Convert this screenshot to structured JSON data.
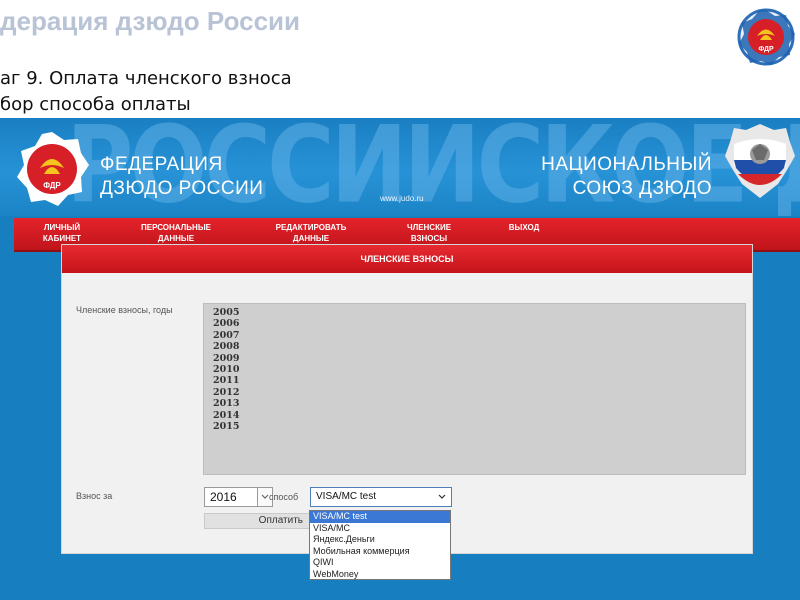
{
  "slide": {
    "title": "дерация дзюдо России",
    "step_line1": "аг 9. Оплата членского взноса",
    "step_line2": "бор способа оплаты",
    "logo_text": "ФДР"
  },
  "screenshot": {
    "banner": {
      "watermark": "РОССИЙСКОЕ ДЗЮДО",
      "emblem_text": "ФДР",
      "federation_line1": "ФЕДЕРАЦИЯ",
      "federation_line2": "ДЗЮДО РОССИИ",
      "site_url": "www.judo.ru",
      "national_line1": "НАЦИОНАЛЬНЫЙ",
      "national_line2": "СОЮЗ ДЗЮДО"
    },
    "nav": {
      "items": [
        {
          "line1": "ЛИЧНЫЙ",
          "line2": "КАБИНЕТ"
        },
        {
          "line1": "ПЕРСОНАЛЬНЫЕ",
          "line2": "ДАННЫЕ"
        },
        {
          "line1": "РЕДАКТИРОВАТЬ",
          "line2": "ДАННЫЕ"
        },
        {
          "line1": "ЧЛЕНСКИЕ",
          "line2": "ВЗНОСЫ"
        },
        {
          "line1": "ВЫХОД",
          "line2": ""
        }
      ]
    },
    "panel": {
      "heading": "ЧЛЕНСКИЕ ВЗНОСЫ",
      "years_label": "Членские взносы, годы",
      "years": [
        "2005",
        "2006",
        "2007",
        "2008",
        "2009",
        "2010",
        "2011",
        "2012",
        "2013",
        "2014",
        "2015"
      ],
      "fee_label": "Взнос за",
      "year_value": "2016",
      "way_label": "способ",
      "payment_value": "VISA/MC test",
      "pay_button": "Оплатить",
      "payment_options": [
        "VISA/MC test",
        "VISA/MC",
        "Яндекс.Деньги",
        "Мобильная коммерция",
        "QIWI",
        "WebMoney"
      ],
      "selected_index": 0
    },
    "colors": {
      "banner_blue": "#1a7fc2",
      "accent_red": "#d41c23",
      "dropdown_selected": "#3b78d6"
    }
  }
}
